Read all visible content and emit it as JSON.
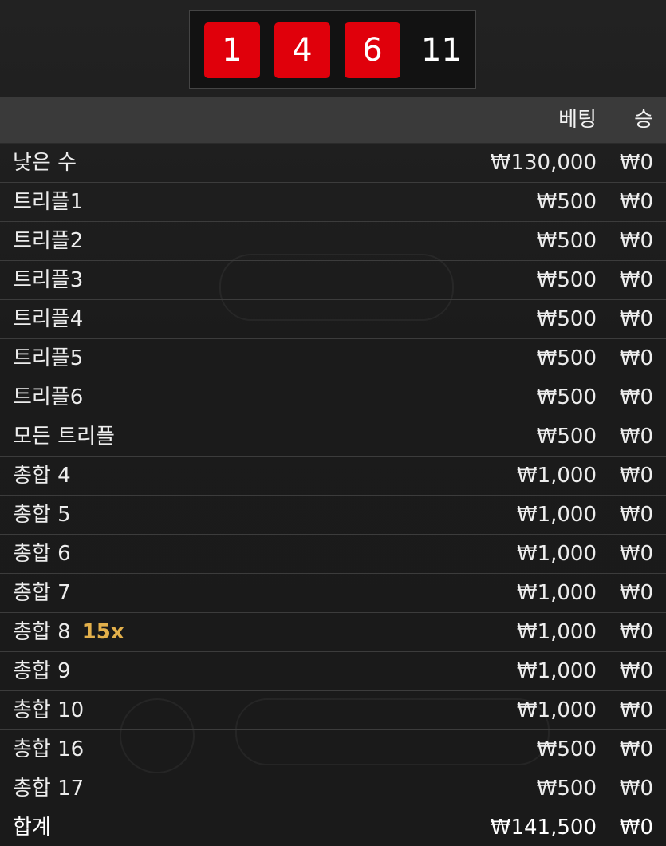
{
  "dice": {
    "values": [
      "1",
      "4",
      "6"
    ],
    "sum": "11",
    "color": "#e0000b"
  },
  "table": {
    "headers": {
      "bet": "베팅",
      "win": "승"
    },
    "rows": [
      {
        "name": "낮은 수",
        "multiplier": "",
        "bet": "₩130,000",
        "win": "₩0"
      },
      {
        "name": "트리플1",
        "multiplier": "",
        "bet": "₩500",
        "win": "₩0"
      },
      {
        "name": "트리플2",
        "multiplier": "",
        "bet": "₩500",
        "win": "₩0"
      },
      {
        "name": "트리플3",
        "multiplier": "",
        "bet": "₩500",
        "win": "₩0"
      },
      {
        "name": "트리플4",
        "multiplier": "",
        "bet": "₩500",
        "win": "₩0"
      },
      {
        "name": "트리플5",
        "multiplier": "",
        "bet": "₩500",
        "win": "₩0"
      },
      {
        "name": "트리플6",
        "multiplier": "",
        "bet": "₩500",
        "win": "₩0"
      },
      {
        "name": "모든 트리플",
        "multiplier": "",
        "bet": "₩500",
        "win": "₩0"
      },
      {
        "name": "총합 4",
        "multiplier": "",
        "bet": "₩1,000",
        "win": "₩0"
      },
      {
        "name": "총합 5",
        "multiplier": "",
        "bet": "₩1,000",
        "win": "₩0"
      },
      {
        "name": "총합 6",
        "multiplier": "",
        "bet": "₩1,000",
        "win": "₩0"
      },
      {
        "name": "총합 7",
        "multiplier": "",
        "bet": "₩1,000",
        "win": "₩0"
      },
      {
        "name": "총합 8",
        "multiplier": "15x",
        "bet": "₩1,000",
        "win": "₩0"
      },
      {
        "name": "총합 9",
        "multiplier": "",
        "bet": "₩1,000",
        "win": "₩0"
      },
      {
        "name": "총합 10",
        "multiplier": "",
        "bet": "₩1,000",
        "win": "₩0"
      },
      {
        "name": "총합 16",
        "multiplier": "",
        "bet": "₩500",
        "win": "₩0"
      },
      {
        "name": "총합 17",
        "multiplier": "",
        "bet": "₩500",
        "win": "₩0"
      }
    ],
    "total": {
      "name": "합계",
      "bet": "₩141,500",
      "win": "₩0"
    }
  },
  "colors": {
    "multiplier": "#e3b04b",
    "header_bg": "#3a3a3a"
  }
}
